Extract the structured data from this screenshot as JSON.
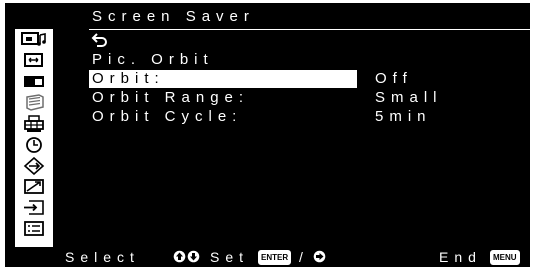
{
  "menu": {
    "title": "Screen Saver",
    "rows": [
      {
        "label": "Pic. Orbit",
        "value": ""
      },
      {
        "label": "Orbit:",
        "value": "Off"
      },
      {
        "label": "Orbit Range:",
        "value": "Small"
      },
      {
        "label": "Orbit Cycle:",
        "value": "5min"
      }
    ]
  },
  "sidebar": {
    "icons": [
      "picture-sound-icon",
      "screen-icon",
      "dual-window-icon",
      "screen-saver-icon",
      "printer-setup-icon",
      "timer-clock-icon",
      "connection-icon",
      "trend-icon",
      "input-icon",
      "menu-list-icon"
    ],
    "selected": "screen-saver-icon"
  },
  "bottom": {
    "select_label": "Select",
    "set_label": "Set",
    "enter_badge": "ENTER",
    "separator": "/",
    "end_label": "End",
    "menu_badge": "MENU"
  }
}
